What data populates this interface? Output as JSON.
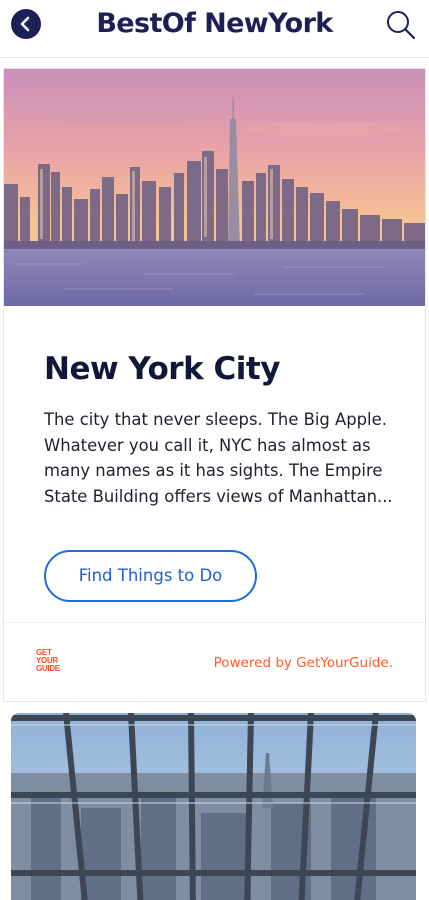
{
  "header": {
    "title": "BestOf NewYork",
    "back_icon": "chevron-left-icon",
    "search_icon": "search-icon"
  },
  "card": {
    "title": "New York City",
    "description": "The city that never sleeps. The Big Apple. Whatever you call it, NYC has almost as many names as it has sights. The Empire State Building offers views of Manhattan...",
    "cta_label": "Find Things to Do",
    "provider_logo": [
      "GET",
      "YOUR",
      "GUIDE"
    ],
    "powered_by": "Powered by GetYourGuide."
  },
  "colors": {
    "navy": "#1c2056",
    "cta_blue": "#1f6bdc",
    "brand_orange": "#ff5b27"
  }
}
